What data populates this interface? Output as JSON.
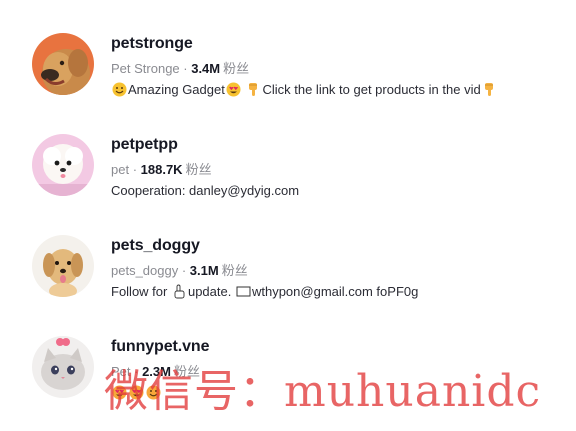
{
  "accounts": [
    {
      "username": "petstronge",
      "nickname": "Pet Stronge",
      "separator": " · ",
      "followers": "3.4M",
      "followers_label": "粉丝",
      "bio": [
        {
          "icon": "smile-face-icon"
        },
        {
          "text": "Amazing Gadget"
        },
        {
          "icon": "heart-eyes-face-icon"
        },
        {
          "text": " "
        },
        {
          "icon": "point-down-hand-icon"
        },
        {
          "text": "Click the link to get products in the vid"
        },
        {
          "icon": "point-down-hand-icon"
        }
      ]
    },
    {
      "username": "petpetpp",
      "nickname": "pet",
      "separator": " · ",
      "followers": "188.7K",
      "followers_label": "粉丝",
      "bio": [
        {
          "text": "Cooperation: danley@ydyig.com"
        }
      ]
    },
    {
      "username": "pets_doggy",
      "nickname": "pets_doggy",
      "separator": " · ",
      "followers": "3.1M",
      "followers_label": "粉丝",
      "bio": [
        {
          "text": "Follow for "
        },
        {
          "icon": "point-up-hand-icon"
        },
        {
          "text": "update. "
        },
        {
          "icon": "envelope-icon"
        },
        {
          "text": "wthypon@gmail.com foPF0g"
        }
      ]
    },
    {
      "username": "funnypet.vne",
      "nickname": "Pet",
      "separator": " · ",
      "followers": "2.3M",
      "followers_label": "粉丝",
      "bio": [
        {
          "icon": "heart-eyes-face-icon"
        },
        {
          "icon": "heart-eyes-face-icon"
        },
        {
          "icon": "smile-face-icon"
        }
      ]
    }
  ],
  "watermark": "微信号：muhuanidc"
}
